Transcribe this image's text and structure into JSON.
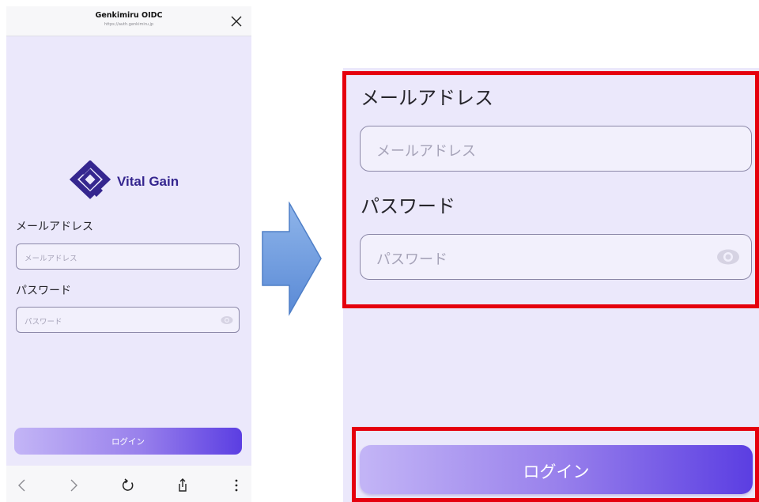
{
  "phone": {
    "browser_title": "Genkimiru OIDC",
    "browser_url": "https://auth.genkimiru.jp",
    "logo_text": "Vital Gain",
    "email_label": "メールアドレス",
    "email_placeholder": "メールアドレス",
    "password_label": "パスワード",
    "password_placeholder": "パスワード",
    "login_label": "ログイン",
    "bottom_bar_icons": [
      "back-icon",
      "forward-icon",
      "reload-icon",
      "share-icon",
      "more-icon"
    ]
  },
  "zoom": {
    "email_label": "メールアドレス",
    "email_placeholder": "メールアドレス",
    "password_label": "パスワード",
    "password_placeholder": "パスワード",
    "login_label": "ログイン"
  },
  "colors": {
    "page_bg": "#ebe8fb",
    "brand": "#35268f",
    "button_gradient_start": "#c3b5f6",
    "button_gradient_end": "#5b3ee2",
    "highlight": "#e5000d",
    "arrow": "#6f9ee0"
  }
}
